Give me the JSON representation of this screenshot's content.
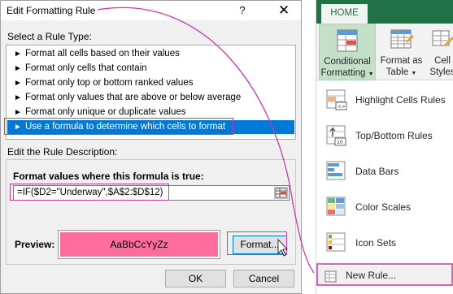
{
  "dialog": {
    "title": "Edit Formatting Rule",
    "help_symbol": "?",
    "close_symbol": "✕",
    "select_rule_type_label": "Select a Rule Type:",
    "rule_types": [
      "Format all cells based on their values",
      "Format only cells that contain",
      "Format only top or bottom ranked values",
      "Format only values that are above or below average",
      "Format only unique or duplicate values",
      "Use a formula to determine which cells to format"
    ],
    "selected_rule_index": 5,
    "edit_description_label": "Edit the Rule Description:",
    "formula_label": "Format values where this formula is true:",
    "formula_value": "=IF($D2=\"Underway\",$A$2:$D$12)",
    "preview_label": "Preview:",
    "preview_text": "AaBbCcYyZz",
    "preview_fill_color": "#ff6c9d",
    "format_button": "Format...",
    "ok_button": "OK",
    "cancel_button": "Cancel"
  },
  "ribbon": {
    "tab_home": "HOME",
    "accent_color": "#217346",
    "conditional_formatting": "Conditional Formatting",
    "conditional_formatting_line1": "Conditional",
    "conditional_formatting_line2": "Formatting",
    "format_as_table_line1": "Format as",
    "format_as_table_line2": "Table",
    "cell_styles_line1": "Cell",
    "cell_styles_line2": "Styles",
    "menu_items": [
      {
        "label": "Highlight Cells Rules",
        "icon": "highlight-cells-icon"
      },
      {
        "label": "Top/Bottom Rules",
        "icon": "top-bottom-icon"
      },
      {
        "label": "Data Bars",
        "icon": "data-bars-icon"
      },
      {
        "label": "Color Scales",
        "icon": "color-scales-icon"
      },
      {
        "label": "Icon Sets",
        "icon": "icon-sets-icon"
      }
    ],
    "new_rule": "New Rule..."
  },
  "annotation_color": "#c63da8"
}
